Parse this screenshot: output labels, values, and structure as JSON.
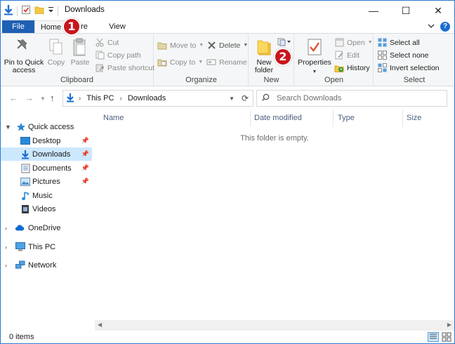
{
  "window": {
    "title": "Downloads",
    "controls": {
      "minimize": "—",
      "maximize": "☐",
      "close": "✕"
    }
  },
  "tabs": {
    "file": "File",
    "home": "Home",
    "share": "re",
    "view": "View"
  },
  "ribbon": {
    "clipboard": {
      "label": "Clipboard",
      "pin": "Pin to Quick access",
      "pin_line1": "Pin to Quick",
      "pin_line2": "access",
      "copy": "Copy",
      "paste": "Paste",
      "cut": "Cut",
      "copy_path": "Copy path",
      "paste_shortcut": "Paste shortcut"
    },
    "organize": {
      "label": "Organize",
      "move_to": "Move to",
      "copy_to": "Copy to",
      "delete": "Delete",
      "rename": "Rename"
    },
    "new": {
      "label": "New",
      "new_folder_line1": "New",
      "new_folder_line2": "folder"
    },
    "open": {
      "label": "Open",
      "properties": "Properties",
      "open": "Open",
      "edit": "Edit",
      "history": "History"
    },
    "select": {
      "label": "Select",
      "select_all": "Select all",
      "select_none": "Select none",
      "invert_selection": "Invert selection"
    }
  },
  "badges": {
    "one": "1",
    "two": "2"
  },
  "address": {
    "crumbs": [
      "This PC",
      "Downloads"
    ],
    "search_placeholder": "Search Downloads"
  },
  "nav": {
    "quick_access": "Quick access",
    "items": [
      "Desktop",
      "Downloads",
      "Documents",
      "Pictures",
      "Music",
      "Videos"
    ],
    "onedrive": "OneDrive",
    "this_pc": "This PC",
    "network": "Network"
  },
  "content": {
    "columns": [
      "Name",
      "Date modified",
      "Type",
      "Size"
    ],
    "empty_message": "This folder is empty."
  },
  "status": {
    "items": "0 items"
  },
  "colors": {
    "accent": "#1f5fb4",
    "selected": "#cce8ff",
    "badge": "#c8161d"
  }
}
